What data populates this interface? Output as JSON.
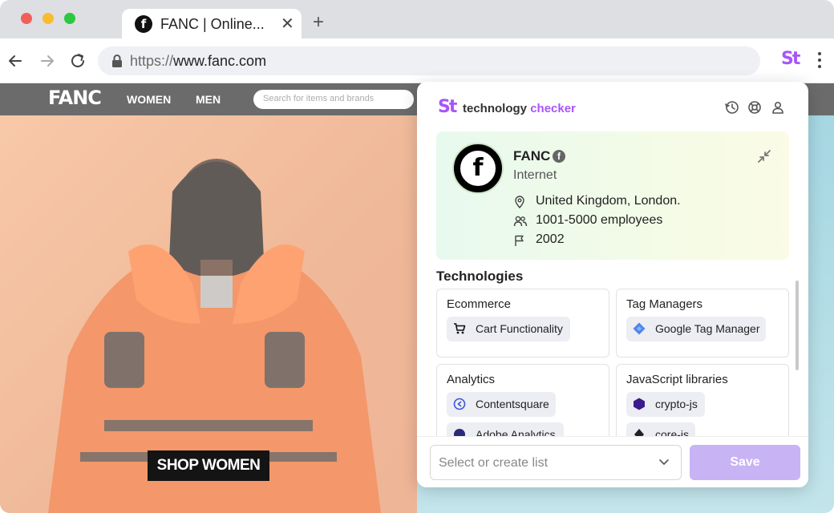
{
  "browser": {
    "tab": {
      "title": "FANC | Online...",
      "favicon": "f",
      "close_glyph": "✕"
    },
    "new_tab_glyph": "+",
    "url": {
      "protocol": "https://",
      "domain": "www.fanc.com"
    },
    "extension_mark": "St",
    "icons": [
      "back-arrow-icon",
      "forward-arrow-icon",
      "reload-icon",
      "lock-icon",
      "menu-dots-icon"
    ]
  },
  "site": {
    "logo": "FANC",
    "nav": {
      "women": "WOMEN",
      "men": "MEN"
    },
    "search_placeholder": "Search for items and brands",
    "hero_cta": "SHOP WOMEN"
  },
  "popup": {
    "logo_mark": "St",
    "title_main": "technology",
    "title_accent": "checker",
    "accent_color": "#a855f7",
    "header_icons": [
      "history-icon",
      "help-icon",
      "user-icon"
    ],
    "company": {
      "name": "FANC",
      "logo_letter": "f",
      "social_glyph": "f",
      "industry": "Internet",
      "location": "United Kingdom, London.",
      "employees": "1001-5000 employees",
      "founded": "2002"
    },
    "technologies_title": "Technologies",
    "categories": [
      {
        "name": "Ecommerce",
        "items": [
          {
            "label": "Cart Functionality",
            "icon": "cart-icon"
          }
        ]
      },
      {
        "name": "Tag Managers",
        "items": [
          {
            "label": "Google Tag Manager",
            "icon": "gtm-icon"
          }
        ]
      },
      {
        "name": "Analytics",
        "items": [
          {
            "label": "Contentsquare",
            "icon": "contentsquare-icon"
          },
          {
            "label": "Adobe Analytics",
            "icon": "adobe-analytics-icon"
          }
        ]
      },
      {
        "name": "JavaScript libraries",
        "items": [
          {
            "label": "crypto-js",
            "icon": "crypto-js-icon"
          },
          {
            "label": "core-js",
            "icon": "core-js-icon"
          }
        ]
      }
    ],
    "list_select_placeholder": "Select or create list",
    "save_label": "Save",
    "save_color": "#c8b3f5"
  }
}
